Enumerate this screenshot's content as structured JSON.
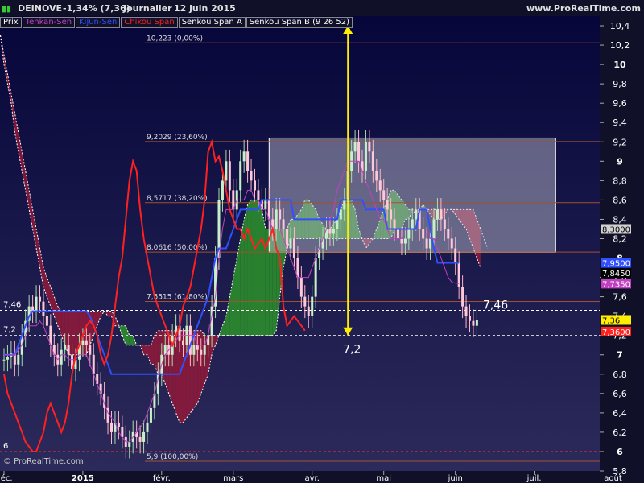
{
  "header": {
    "ticker": "DEINOVE",
    "change": "-1,34% (7,36)",
    "period": "Journalier",
    "date": "12 juin 2015",
    "site": "www.ProRealTime.com"
  },
  "legend": [
    {
      "label": "Prix",
      "color": "#ffffff"
    },
    {
      "label": "Tenkan-Sen",
      "color": "#c040c0"
    },
    {
      "label": "Kijun-Sen",
      "color": "#3050ff"
    },
    {
      "label": "Chikou Span",
      "color": "#ff2020"
    },
    {
      "label": "Senkou Span A",
      "color": "#ffffff"
    },
    {
      "label": "Senkou Span B (9 26 52)",
      "color": "#ffffff"
    }
  ],
  "copyright": "© ProRealTime.com",
  "colors": {
    "bull": "#2b8c2b",
    "bear": "#8c1a3a",
    "tenkan": "#c040c0",
    "kijun": "#3050ff",
    "chikou": "#ff2020",
    "fib": "#a0522d",
    "arrow": "#ffee00"
  },
  "chart_data": {
    "type": "candlestick",
    "ylim": [
      5.8,
      10.5
    ],
    "y_ticks": [
      "5,8",
      "6",
      "6,2",
      "6,4",
      "6,6",
      "6,8",
      "7",
      "7,2",
      "7,4",
      "7,6",
      "7,8",
      "8",
      "8,2",
      "8,4",
      "8,6",
      "8,8",
      "9",
      "9,2",
      "9,4",
      "9,6",
      "9,8",
      "10",
      "10,2",
      "10,4"
    ],
    "y_ticks_values": [
      5.8,
      6,
      6.2,
      6.4,
      6.6,
      6.8,
      7,
      7.2,
      7.4,
      7.6,
      7.8,
      8,
      8.2,
      8.4,
      8.6,
      8.8,
      9,
      9.2,
      9.4,
      9.6,
      9.8,
      10,
      10.2,
      10.4
    ],
    "x_labels": [
      {
        "label": "déc.",
        "i": 0
      },
      {
        "label": "2015",
        "i": 22
      },
      {
        "label": "févr.",
        "i": 44
      },
      {
        "label": "mars",
        "i": 64
      },
      {
        "label": "avr.",
        "i": 86
      },
      {
        "label": "mai",
        "i": 106
      },
      {
        "label": "juin",
        "i": 126
      },
      {
        "label": "juil.",
        "i": 148
      },
      {
        "label": "août",
        "i": 170
      }
    ],
    "fibonacci": [
      {
        "label": "10,223 (0,00%)",
        "value": 10.223
      },
      {
        "label": "9,2029 (23,60%)",
        "value": 9.2029
      },
      {
        "label": "8,5717 (38,20%)",
        "value": 8.5717
      },
      {
        "label": "8,0616 (50,00%)",
        "value": 8.0616
      },
      {
        "label": "7,5515 (61,80%)",
        "value": 7.5515
      },
      {
        "label": "5,9 (100,00%)",
        "value": 5.9
      }
    ],
    "levels": [
      {
        "label": "7,46",
        "value": 7.46
      },
      {
        "label": "7,2",
        "value": 7.2
      },
      {
        "label": "6",
        "value": 6.0
      }
    ],
    "annotations": [
      {
        "text": "7,46",
        "value": 7.46
      },
      {
        "text": "7,2",
        "value": 7.2
      }
    ],
    "right_tags": [
      {
        "label": "8,3000",
        "value": 8.3,
        "bg": "#d0d0d0",
        "fg": "#000"
      },
      {
        "label": "7,9500",
        "value": 7.95,
        "bg": "#3050ff",
        "fg": "#fff"
      },
      {
        "label": "7,8450",
        "value": 7.845,
        "bg": "#000",
        "fg": "#fff"
      },
      {
        "label": "7,7350",
        "value": 7.735,
        "bg": "#c040c0",
        "fg": "#fff"
      },
      {
        "label": "7,36",
        "value": 7.36,
        "bg": "#ffee00",
        "fg": "#000"
      },
      {
        "label": "7,3600",
        "value": 7.24,
        "bg": "#ff2020",
        "fg": "#fff"
      }
    ],
    "rect_zone": {
      "y_top": 9.24,
      "y_bottom": 8.06,
      "i_start": 74,
      "i_end": 154
    },
    "price_close": [
      6.95,
      6.98,
      7.02,
      6.9,
      7.0,
      7.2,
      7.35,
      7.5,
      7.45,
      7.6,
      7.55,
      7.4,
      7.3,
      7.1,
      7.0,
      6.9,
      7.05,
      7.1,
      7.0,
      6.85,
      6.95,
      7.1,
      7.15,
      7.1,
      7.0,
      6.8,
      6.7,
      6.6,
      6.45,
      6.3,
      6.2,
      6.3,
      6.25,
      6.15,
      6.05,
      6.1,
      6.2,
      6.15,
      6.1,
      6.2,
      6.3,
      6.45,
      6.6,
      6.8,
      7.0,
      7.1,
      7.0,
      7.2,
      7.3,
      7.15,
      7.1,
      7.3,
      7.0,
      7.1,
      7.05,
      7.0,
      7.1,
      7.2,
      7.5,
      8.0,
      8.6,
      8.8,
      9.0,
      8.7,
      8.5,
      8.7,
      9.0,
      9.1,
      8.9,
      8.8,
      8.7,
      8.6,
      8.5,
      8.6,
      8.4,
      8.3,
      8.5,
      8.4,
      8.3,
      8.1,
      8.2,
      8.0,
      7.8,
      7.6,
      7.5,
      7.4,
      7.6,
      8.0,
      8.1,
      8.2,
      8.3,
      8.25,
      8.3,
      8.4,
      8.5,
      8.6,
      8.9,
      9.1,
      9.2,
      9.0,
      8.9,
      9.2,
      9.1,
      8.9,
      8.8,
      8.7,
      8.6,
      8.5,
      8.4,
      8.3,
      8.2,
      8.15,
      8.2,
      8.3,
      8.4,
      8.5,
      8.3,
      8.2,
      8.1,
      8.2,
      8.4,
      8.5,
      8.4,
      8.3,
      8.2,
      8.1,
      7.95,
      7.7,
      7.5,
      7.4,
      7.35,
      7.3,
      7.36
    ],
    "tenkan": [
      7.0,
      7.0,
      7.0,
      7.0,
      7.05,
      7.1,
      7.2,
      7.3,
      7.3,
      7.3,
      7.35,
      7.3,
      7.2,
      7.1,
      7.0,
      6.95,
      7.0,
      7.0,
      6.95,
      6.95,
      6.95,
      7.0,
      7.0,
      7.0,
      6.9,
      6.8,
      6.7,
      6.6,
      6.5,
      6.4,
      6.35,
      6.3,
      6.2,
      6.15,
      6.1,
      6.1,
      6.15,
      6.2,
      6.25,
      6.3,
      6.4,
      6.5,
      6.6,
      6.75,
      6.9,
      7.0,
      7.05,
      7.1,
      7.15,
      7.2,
      7.2,
      7.2,
      7.2,
      7.2,
      7.1,
      7.1,
      7.1,
      7.2,
      7.4,
      7.6,
      8.0,
      8.3,
      8.5,
      8.5,
      8.5,
      8.6,
      8.6,
      8.6,
      8.7,
      8.7,
      8.6,
      8.6,
      8.5,
      8.5,
      8.4,
      8.3,
      8.3,
      8.3,
      8.2,
      8.1,
      8.0,
      7.9,
      7.8,
      7.8,
      7.8,
      7.8,
      7.9,
      8.0,
      8.1,
      8.2,
      8.3,
      8.4,
      8.5,
      8.7,
      8.8,
      8.9,
      9.0,
      9.0,
      9.0,
      9.0,
      8.9,
      8.8,
      8.7,
      8.6,
      8.5,
      8.4,
      8.4,
      8.3,
      8.2,
      8.2,
      8.2,
      8.2,
      8.3,
      8.3,
      8.3,
      8.3,
      8.3,
      8.3,
      8.3,
      8.2,
      8.2,
      8.1,
      8.0,
      7.9,
      7.8,
      7.75,
      7.74,
      7.735
    ],
    "kijun": [
      7.0,
      7.0,
      7.0,
      7.0,
      7.1,
      7.2,
      7.3,
      7.4,
      7.45,
      7.45,
      7.45,
      7.45,
      7.45,
      7.45,
      7.45,
      7.45,
      7.45,
      7.45,
      7.45,
      7.45,
      7.45,
      7.45,
      7.45,
      7.45,
      7.4,
      7.3,
      7.2,
      7.1,
      7.0,
      6.9,
      6.8,
      6.8,
      6.8,
      6.8,
      6.8,
      6.8,
      6.8,
      6.8,
      6.8,
      6.8,
      6.8,
      6.8,
      6.8,
      6.8,
      6.8,
      6.8,
      6.8,
      6.8,
      6.8,
      6.8,
      6.9,
      7.0,
      7.1,
      7.2,
      7.3,
      7.4,
      7.5,
      7.6,
      7.8,
      8.0,
      8.1,
      8.1,
      8.1,
      8.2,
      8.3,
      8.4,
      8.5,
      8.5,
      8.5,
      8.5,
      8.5,
      8.5,
      8.6,
      8.6,
      8.6,
      8.6,
      8.6,
      8.6,
      8.6,
      8.6,
      8.6,
      8.4,
      8.4,
      8.4,
      8.4,
      8.4,
      8.4,
      8.4,
      8.4,
      8.4,
      8.4,
      8.4,
      8.4,
      8.4,
      8.6,
      8.6,
      8.6,
      8.6,
      8.6,
      8.6,
      8.6,
      8.5,
      8.5,
      8.5,
      8.5,
      8.5,
      8.5,
      8.3,
      8.3,
      8.3,
      8.3,
      8.3,
      8.3,
      8.3,
      8.3,
      8.3,
      8.5,
      8.5,
      8.5,
      8.3,
      8.1,
      7.95,
      7.95,
      7.95,
      7.95,
      7.95,
      7.95,
      7.95
    ],
    "chikou": [
      6.8,
      6.6,
      6.5,
      6.4,
      6.3,
      6.2,
      6.1,
      6.05,
      6.0,
      6.0,
      6.1,
      6.2,
      6.4,
      6.5,
      6.4,
      6.3,
      6.2,
      6.3,
      6.5,
      6.8,
      7.0,
      7.1,
      7.2,
      7.3,
      7.35,
      7.3,
      7.2,
      7.0,
      6.9,
      7.0,
      7.2,
      7.5,
      7.8,
      8.0,
      8.4,
      8.8,
      9.0,
      8.9,
      8.5,
      8.2,
      8.0,
      7.8,
      7.6,
      7.5,
      7.4,
      7.3,
      7.2,
      7.1,
      7.2,
      7.3,
      7.5,
      7.6,
      7.7,
      7.9,
      8.1,
      8.3,
      8.6,
      9.1,
      9.2,
      9.0,
      9.05,
      8.9,
      8.7,
      8.5,
      8.4,
      8.3,
      8.3,
      8.2,
      8.3,
      8.2,
      8.1,
      8.15,
      8.2,
      8.1,
      8.2,
      8.3,
      8.1,
      8.0,
      7.5,
      7.3,
      7.35,
      7.4,
      7.35,
      7.3,
      7.25
    ],
    "span_a": [
      10.3,
      10.0,
      9.8,
      9.6,
      9.3,
      9.1,
      8.9,
      8.7,
      8.5,
      8.3,
      8.1,
      7.9,
      7.7,
      7.6,
      7.5,
      7.4,
      7.3,
      7.2,
      7.1,
      7.0,
      7.0,
      7.0,
      7.0,
      7.0,
      7.0,
      7.1,
      7.2,
      7.3,
      7.4,
      7.45,
      7.4,
      7.4,
      7.3,
      7.3,
      7.3,
      7.3,
      7.2,
      7.2,
      7.1,
      7.1,
      7.0,
      7.0,
      6.9,
      6.9,
      6.8,
      6.8,
      6.7,
      6.6,
      6.5,
      6.4,
      6.3,
      6.3,
      6.35,
      6.4,
      6.45,
      6.5,
      6.6,
      6.7,
      6.8,
      7.0,
      7.1,
      7.2,
      7.3,
      7.4,
      7.6,
      7.8,
      8.0,
      8.2,
      8.4,
      8.55,
      8.6,
      8.6,
      8.6,
      8.5,
      8.3,
      8.3,
      8.3,
      8.3,
      8.3,
      8.3,
      8.3,
      8.4,
      8.4,
      8.45,
      8.5,
      8.6,
      8.6,
      8.55,
      8.5,
      8.4,
      8.35,
      8.3,
      8.3,
      8.35,
      8.4,
      8.5,
      8.6,
      8.6,
      8.6,
      8.5,
      8.3,
      8.2,
      8.1,
      8.15,
      8.2,
      8.3,
      8.4,
      8.5,
      8.6,
      8.7,
      8.7,
      8.65,
      8.6,
      8.55,
      8.5,
      8.5,
      8.45,
      8.5,
      8.55,
      8.5,
      8.45,
      8.4,
      8.4,
      8.4,
      8.45,
      8.5,
      8.5,
      8.45,
      8.4,
      8.35,
      8.3,
      8.2,
      8.1,
      8.0,
      7.9
    ],
    "span_b": [
      10.3,
      10.1,
      9.9,
      9.7,
      9.5,
      9.3,
      9.1,
      8.9,
      8.7,
      8.5,
      8.3,
      8.1,
      7.9,
      7.8,
      7.7,
      7.6,
      7.5,
      7.45,
      7.45,
      7.45,
      7.45,
      7.45,
      7.45,
      7.45,
      7.45,
      7.45,
      7.45,
      7.45,
      7.45,
      7.45,
      7.45,
      7.45,
      7.4,
      7.3,
      7.2,
      7.1,
      7.1,
      7.1,
      7.1,
      7.1,
      7.1,
      7.1,
      7.1,
      7.2,
      7.25,
      7.25,
      7.25,
      7.25,
      7.25,
      7.25,
      7.25,
      7.25,
      7.25,
      7.25,
      7.25,
      7.25,
      7.25,
      7.2,
      7.2,
      7.2,
      7.2,
      7.2,
      7.2,
      7.2,
      7.2,
      7.2,
      7.2,
      7.2,
      7.2,
      7.2,
      7.2,
      7.2,
      7.2,
      7.2,
      7.2,
      7.2,
      7.2,
      7.25,
      7.6,
      7.9,
      8.1,
      8.2,
      8.2,
      8.2,
      8.2,
      8.2,
      8.2,
      8.2,
      8.2,
      8.2,
      8.2,
      8.2,
      8.2,
      8.2,
      8.2,
      8.2,
      8.2,
      8.2,
      8.2,
      8.2,
      8.2,
      8.2,
      8.2,
      8.2,
      8.2,
      8.2,
      8.2,
      8.2,
      8.2,
      8.2,
      8.3,
      8.3,
      8.3,
      8.4,
      8.4,
      8.5,
      8.5,
      8.5,
      8.5,
      8.5,
      8.5,
      8.5,
      8.5,
      8.5,
      8.5,
      8.5,
      8.5,
      8.5,
      8.5,
      8.5,
      8.5,
      8.5,
      8.5,
      8.4,
      8.3,
      8.2,
      8.1
    ]
  }
}
